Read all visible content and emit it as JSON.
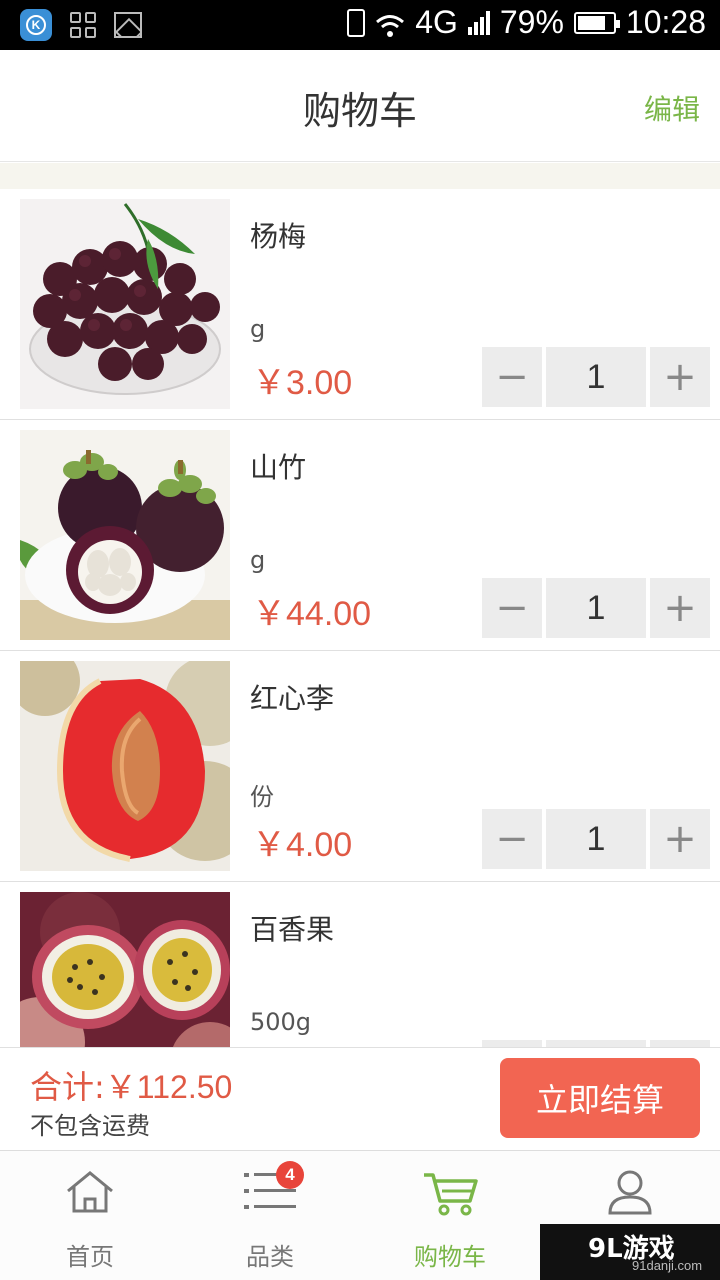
{
  "status_bar": {
    "network": "4G",
    "battery": "79%",
    "battery_level": 0.79,
    "time": "10:28"
  },
  "header": {
    "title": "购物车",
    "edit_label": "编辑"
  },
  "cart": {
    "items": [
      {
        "name": "杨梅",
        "unit": "g",
        "price": "￥3.00",
        "quantity": "1",
        "image": "bayberry"
      },
      {
        "name": "山竹",
        "unit": "g",
        "price": "￥44.00",
        "quantity": "1",
        "image": "mangosteen"
      },
      {
        "name": "红心李",
        "unit": "份",
        "price": "￥4.00",
        "quantity": "1",
        "image": "red-plum"
      },
      {
        "name": "百香果",
        "unit": "500g",
        "price": "",
        "quantity": "",
        "image": "passion-fruit"
      }
    ],
    "minus_symbol": "−",
    "plus_symbol": "+"
  },
  "summary": {
    "total_label": "合计:",
    "total_amount": "￥112.50",
    "shipping_note": "不包含运费",
    "checkout_label": "立即结算"
  },
  "tabbar": {
    "tabs": [
      {
        "label": "首页",
        "icon": "home-icon"
      },
      {
        "label": "品类",
        "icon": "list-icon"
      },
      {
        "label": "购物车",
        "icon": "cart-icon"
      },
      {
        "label": "",
        "icon": "user-icon"
      }
    ],
    "cart_badge": "4",
    "active_color": "#7ab648",
    "accent_price_color": "#e05a45",
    "checkout_color": "#f26552"
  },
  "watermark": {
    "logo": "9L游戏",
    "site": "91danji.com"
  }
}
